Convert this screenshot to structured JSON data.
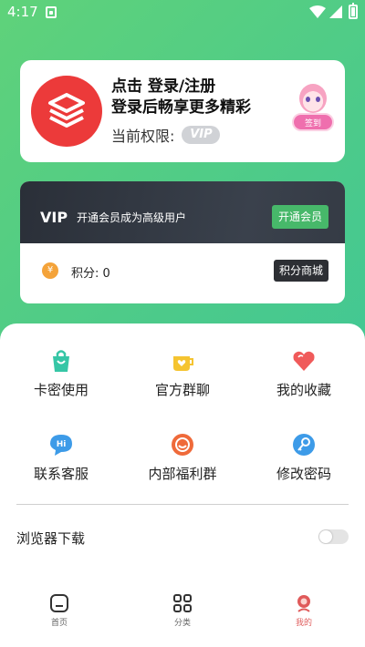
{
  "status_bar": {
    "time": "4:17"
  },
  "profile": {
    "line1_prefix": "点击 ",
    "login_link": "登录/注册",
    "line2": "登录后畅享更多精彩",
    "permission_label": "当前权限:",
    "vip_badge": "VIP",
    "checkin_label": "签到"
  },
  "vip_card": {
    "title": "VIP",
    "description": "开通会员成为高级用户",
    "open_button": "开通会员",
    "coin_symbol": "¥",
    "points_text": "积分: 0",
    "mall_button": "积分商城"
  },
  "menu": {
    "items": [
      {
        "label": "卡密使用",
        "icon": "shopping-bag-icon",
        "color": "#36c6a6"
      },
      {
        "label": "官方群聊",
        "icon": "heart-cup-icon",
        "color": "#f5c430"
      },
      {
        "label": "我的收藏",
        "icon": "heart-icon",
        "color": "#f05a5a"
      },
      {
        "label": "联系客服",
        "icon": "chat-bubble-icon",
        "color": "#3d9be8"
      },
      {
        "label": "内部福利群",
        "icon": "smile-icon",
        "color": "#ef6a3a"
      },
      {
        "label": "修改密码",
        "icon": "key-icon",
        "color": "#3d9be8"
      }
    ]
  },
  "settings": {
    "browser_download_label": "浏览器下载",
    "browser_download_enabled": false
  },
  "tabbar": {
    "tabs": [
      {
        "label": "首页",
        "icon": "home-icon"
      },
      {
        "label": "分类",
        "icon": "grid-icon"
      },
      {
        "label": "我的",
        "icon": "profile-icon",
        "active": true
      }
    ]
  }
}
